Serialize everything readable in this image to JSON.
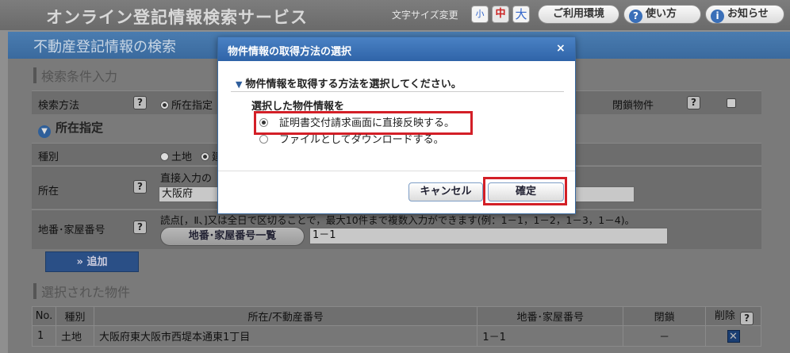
{
  "header": {
    "app_title": "オンライン登記情報検索サービス",
    "font_size_label": "文字サイズ変更",
    "font_size_small": "小",
    "font_size_medium": "中",
    "font_size_large": "大",
    "env_button": "ご利用環境",
    "help_button": "使い方",
    "news_button": "お知らせ"
  },
  "page": {
    "title": "不動産登記情報の検索",
    "search_conditions_heading": "検索条件入力",
    "search_method_label": "検索方法",
    "search_method_option": "所在指定",
    "closed_property_label": "閉鎖物件",
    "location_mode_heading": "所在指定",
    "type_label": "種別",
    "type_option_land": "土地",
    "type_option_building": "建",
    "location_label": "所在",
    "location_hint": "直接入力の",
    "location_value": "大阪府",
    "lot_label": "地番･家屋番号",
    "lot_hint": "読点[，Ⅱ、]又は全日で区切ることで，最大10件まで複数入力ができます(例：1－1，1－2，1－3，1－4)。",
    "lot_list_button": "地番･家屋番号一覧",
    "lot_value": "1－1",
    "add_button": "» 追加",
    "selected_heading": "選択された物件"
  },
  "table": {
    "headers": [
      "No.",
      "種別",
      "所在/不動産番号",
      "地番･家屋番号",
      "閉鎖",
      "削除"
    ],
    "rows": [
      {
        "no": "1",
        "type": "土地",
        "location": "大阪府東大阪市西堤本通東1丁目",
        "lot": "1－1",
        "closed": "－"
      }
    ]
  },
  "modal": {
    "title": "物件情報の取得方法の選択",
    "close": "×",
    "heading": "物件情報を取得する方法を選択してください。",
    "sub": "選択した物件情報を",
    "option_1": "証明書交付請求画面に直接反映する。",
    "option_2": "ファイルとしてダウンロードする。",
    "cancel_button": "キャンセル",
    "ok_button": "確定"
  }
}
